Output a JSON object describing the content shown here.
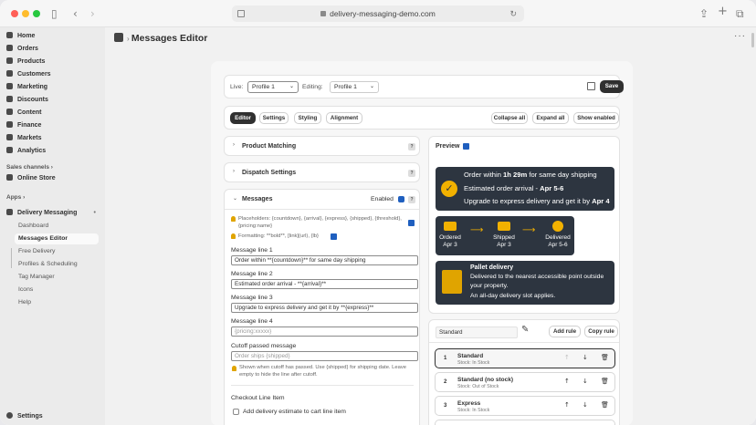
{
  "browser": {
    "url": "delivery-messaging-demo.com"
  },
  "sidebar": {
    "items": [
      {
        "label": "Home",
        "icon": "home-icon"
      },
      {
        "label": "Orders",
        "icon": "orders-icon"
      },
      {
        "label": "Products",
        "icon": "products-icon"
      },
      {
        "label": "Customers",
        "icon": "customers-icon"
      },
      {
        "label": "Marketing",
        "icon": "marketing-icon"
      },
      {
        "label": "Discounts",
        "icon": "discounts-icon"
      },
      {
        "label": "Content",
        "icon": "content-icon"
      },
      {
        "label": "Finance",
        "icon": "finance-icon"
      },
      {
        "label": "Markets",
        "icon": "markets-icon"
      },
      {
        "label": "Analytics",
        "icon": "analytics-icon"
      }
    ],
    "sales_channels_label": "Sales channels",
    "online_store_label": "Online Store",
    "apps_label": "Apps",
    "app_name": "Delivery Messaging",
    "app_subitems": [
      "Dashboard",
      "Messages Editor",
      "Free Delivery",
      "Profiles & Scheduling",
      "Tag Manager",
      "Icons",
      "Help"
    ],
    "settings_label": "Settings"
  },
  "page": {
    "title": "Messages Editor"
  },
  "toolbar": {
    "live_label": "Live:",
    "live_value": "Profile 1",
    "editing_label": "Editing:",
    "editing_value": "Profile 1",
    "save_label": "Save"
  },
  "tabs": [
    "Editor",
    "Settings",
    "Styling",
    "Alignment"
  ],
  "actions": {
    "collapse_all": "Collapse all",
    "expand_all": "Expand all",
    "show_enabled": "Show enabled"
  },
  "sections": {
    "product_matching": "Product Matching",
    "dispatch_settings": "Dispatch Settings",
    "messages": "Messages",
    "enabled_label": "Enabled",
    "qmark": "?"
  },
  "messages": {
    "placeholders_hint": "Placeholders: {countdown}, {arrival}, {express}, {shipped}, {threshold}, {pricing:name}",
    "formatting_hint": "Formatting: **bold**, [link](url), {lb}",
    "line1_label": "Message line 1",
    "line1_value": "Order within **{countdown}** for same day shipping",
    "line2_label": "Message line 2",
    "line2_value": "Estimated order arrival - **{arrival}**",
    "line3_label": "Message line 3",
    "line3_value": "Upgrade to express delivery and get it by **{express}**",
    "line4_label": "Message line 4",
    "line4_placeholder": "{pricing:xxxxx}",
    "cutoff_label": "Cutoff passed message",
    "cutoff_placeholder": "Order ships {shipped}",
    "cutoff_hint": "Shown when cutoff has passed. Use {shipped} for shipping date. Leave empty to hide the line after cutoff.",
    "checkout_title": "Checkout Line Item",
    "checkout_option": "Add delivery estimate to cart line item"
  },
  "preview": {
    "title": "Preview",
    "line1_pre": "Order within ",
    "line1_bold": "1h 29m",
    "line1_post": " for same day shipping",
    "line2_pre": "Estimated order arrival - ",
    "line2_bold": "Apr 5-6",
    "line3_pre": "Upgrade to express delivery and get it by ",
    "line3_bold": "Apr 4",
    "steps": [
      {
        "label": "Ordered",
        "date": "Apr 3"
      },
      {
        "label": "Shipped",
        "date": "Apr 3"
      },
      {
        "label": "Delivered",
        "date": "Apr 5-6"
      }
    ],
    "pallet_title": "Pallet delivery",
    "pallet_line1": "Delivered to the nearest accessible point outside",
    "pallet_line2": "your property.",
    "pallet_line3": "An all-day delivery slot applies."
  },
  "rules": {
    "name_value": "Standard",
    "add_rule": "Add rule",
    "copy_rule": "Copy rule",
    "items": [
      {
        "num": "1",
        "name": "Standard",
        "sub": "Stock: In Stock"
      },
      {
        "num": "2",
        "name": "Standard (no stock)",
        "sub": "Stock: Out of Stock"
      },
      {
        "num": "3",
        "name": "Express",
        "sub": "Stock: In Stock"
      }
    ]
  },
  "colors": {
    "accent": "#303030",
    "preview_bg": "#2d3540",
    "highlight": "#f2b100",
    "link_blue": "#1f5fbf"
  }
}
